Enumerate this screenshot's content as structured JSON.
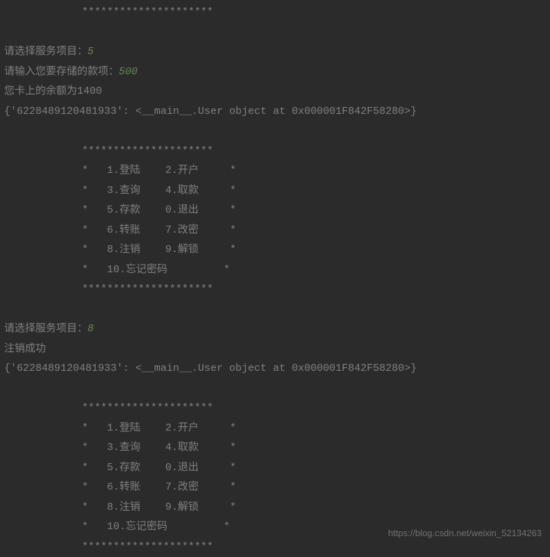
{
  "menu_bottom_border": "*********************",
  "prompt_select_label": "请选择服务项目：",
  "input_select_1": "5",
  "prompt_deposit_label": "请输入您要存储的款项：",
  "input_deposit": "500",
  "balance_line": "您卡上的余额为1400",
  "dict_line": "{'6228489120481933': <__main__.User object at 0x000001F842F58280>}",
  "menu": {
    "border": "*********************",
    "row1": "*   1.登陆    2.开户     *",
    "row2": "*   3.查询    4.取款     *",
    "row3": "*   5.存款    0.退出     *",
    "row4": "*   6.转账    7.改密     *",
    "row5": "*   8.注销    9.解锁     *",
    "row6": "*   10.忘记密码         *"
  },
  "input_select_2": "8",
  "logout_success": "注销成功",
  "watermark": "https://blog.csdn.net/weixin_52134263"
}
